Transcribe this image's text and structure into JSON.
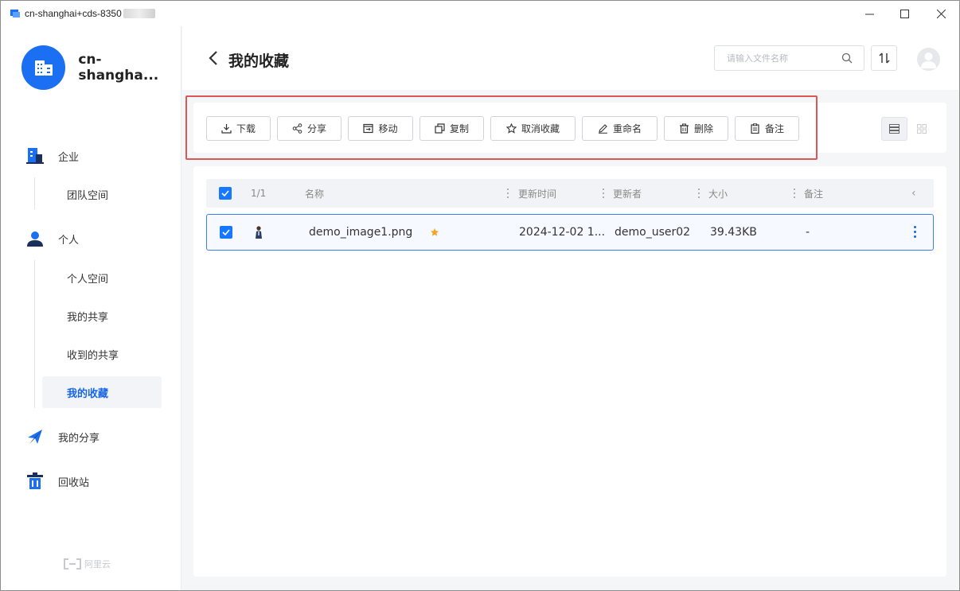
{
  "window": {
    "title": "cn-shanghai+cds-8350",
    "minimize": "—",
    "maximize": "☐",
    "close": "✕"
  },
  "workspace": {
    "name": "cn-shangha..."
  },
  "sidebar": {
    "groups": [
      {
        "label": "企业",
        "icon": "building-icon",
        "items": [
          {
            "label": "团队空间"
          }
        ]
      },
      {
        "label": "个人",
        "icon": "person-icon",
        "items": [
          {
            "label": "个人空间"
          },
          {
            "label": "我的共享"
          },
          {
            "label": "收到的共享"
          },
          {
            "label": "我的收藏",
            "active": true
          }
        ]
      },
      {
        "label": "我的分享",
        "icon": "paper-plane-icon",
        "items": []
      },
      {
        "label": "回收站",
        "icon": "trash-bin-icon",
        "items": []
      }
    ],
    "brand": "阿里云"
  },
  "header": {
    "title": "我的收藏",
    "search_placeholder": "请输入文件名称"
  },
  "toolbar": {
    "buttons": [
      {
        "label": "下载",
        "icon": "download-icon"
      },
      {
        "label": "分享",
        "icon": "share-icon"
      },
      {
        "label": "移动",
        "icon": "move-icon"
      },
      {
        "label": "复制",
        "icon": "copy-icon"
      },
      {
        "label": "取消收藏",
        "icon": "star-outline-icon"
      },
      {
        "label": "重命名",
        "icon": "rename-icon"
      },
      {
        "label": "删除",
        "icon": "delete-icon"
      },
      {
        "label": "备注",
        "icon": "note-icon"
      }
    ]
  },
  "table": {
    "count": "1/1",
    "columns": [
      "名称",
      "更新时间",
      "更新者",
      "大小",
      "备注"
    ],
    "collapse_icon": "‹",
    "rows": [
      {
        "selected": true,
        "name": "demo_image1.png",
        "starred": true,
        "updated": "2024-12-02 1...",
        "updater": "demo_user02",
        "size": "39.43KB",
        "note": "-"
      }
    ]
  },
  "colors": {
    "accent": "#1677ff",
    "highlight_box": "#e05555",
    "star": "#f5a623"
  }
}
